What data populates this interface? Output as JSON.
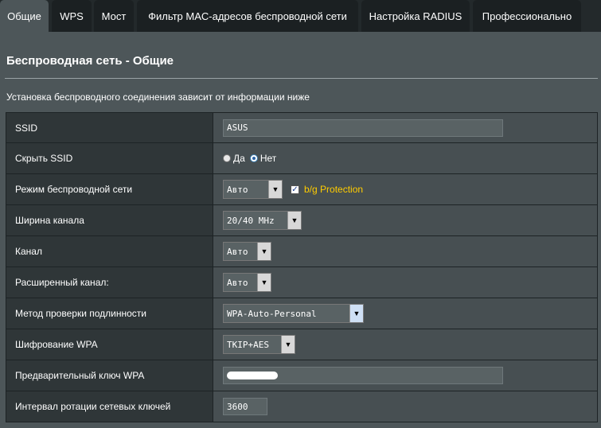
{
  "tabs": [
    {
      "label": "Общие",
      "active": true
    },
    {
      "label": "WPS",
      "active": false
    },
    {
      "label": "Мост",
      "active": false
    },
    {
      "label": "Фильтр MAC-адресов беспроводной сети",
      "active": false
    },
    {
      "label": "Настройка RADIUS",
      "active": false
    },
    {
      "label": "Профессионально",
      "active": false
    }
  ],
  "page": {
    "title": "Беспроводная сеть - Общие",
    "description": "Установка беспроводного соединения зависит от информации ниже"
  },
  "form": {
    "ssid": {
      "label": "SSID",
      "value": "ASUS"
    },
    "hide_ssid": {
      "label": "Скрыть SSID",
      "option_yes": "Да",
      "option_no": "Нет",
      "selected": "Нет"
    },
    "wireless_mode": {
      "label": "Режим беспроводной сети",
      "value": "Авто",
      "bg_protection_label": "b/g Protection",
      "bg_protection_checked": true
    },
    "channel_width": {
      "label": "Ширина канала",
      "value": "20/40 MHz"
    },
    "channel": {
      "label": "Канал",
      "value": "Авто"
    },
    "ext_channel": {
      "label": "Расширенный канал:",
      "value": "Авто"
    },
    "auth_method": {
      "label": "Метод проверки подлинности",
      "value": "WPA-Auto-Personal"
    },
    "wpa_encryption": {
      "label": "Шифрование WPA",
      "value": "TKIP+AES"
    },
    "wpa_psk": {
      "label": "Предварительный ключ WPA",
      "value_masked": true
    },
    "key_rotation": {
      "label": "Интервал ротации сетевых ключей",
      "value": "3600"
    }
  },
  "colors": {
    "background": "#4d5659",
    "accent_yellow": "#ffcc00"
  }
}
